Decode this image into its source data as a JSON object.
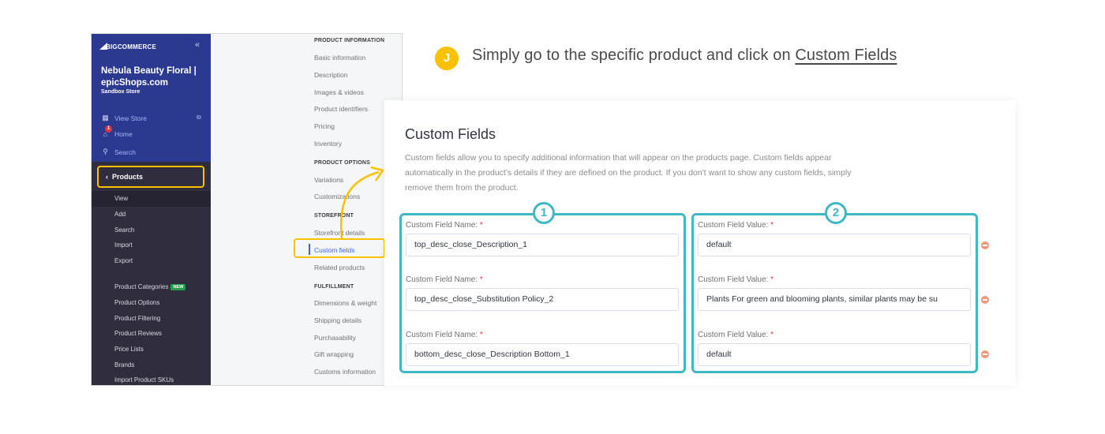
{
  "step": {
    "badge": "J",
    "text": "Simply go to the specific product and click on ",
    "link": "Custom Fields"
  },
  "sidebar": {
    "logo": "BIGCOMMERCE",
    "store_name": "Nebula Beauty Floral | epicShops.com",
    "store_type": "Sandbox Store",
    "top_items": [
      {
        "label": "View Store",
        "icon": "storefront-icon"
      },
      {
        "label": "Home",
        "icon": "home-icon",
        "badge": "1"
      },
      {
        "label": "Search",
        "icon": "search-icon"
      }
    ],
    "section": "Products",
    "sub_items": [
      "View",
      "Add",
      "Search",
      "Import",
      "Export"
    ],
    "more_items": [
      {
        "label": "Product Categories",
        "badge": "NEW"
      },
      {
        "label": "Product Options"
      },
      {
        "label": "Product Filtering"
      },
      {
        "label": "Product Reviews"
      },
      {
        "label": "Price Lists"
      },
      {
        "label": "Brands"
      },
      {
        "label": "Import Product SKUs"
      }
    ]
  },
  "subnav": {
    "sections": [
      {
        "heading": "PRODUCT INFORMATION",
        "items": [
          "Basic information",
          "Description",
          "Images & videos",
          "Product identifiers",
          "Pricing",
          "Inventory"
        ]
      },
      {
        "heading": "PRODUCT OPTIONS",
        "items": [
          "Variations",
          "Customizations"
        ]
      },
      {
        "heading": "STOREFRONT",
        "items": [
          "Storefront details",
          "Custom fields",
          "Related products"
        ]
      },
      {
        "heading": "FULFILLMENT",
        "items": [
          "Dimensions & weight",
          "Shipping details",
          "Purchasability",
          "Gift wrapping",
          "Customs information"
        ]
      }
    ],
    "active": "Custom fields"
  },
  "card": {
    "title": "Custom Fields",
    "description": "Custom fields allow you to specify additional information that will appear on the products page. Custom fields appear automatically in the product's details if they are defined on the product. If you don't want to show any custom fields, simply remove them from the product.",
    "name_label": "Custom Field Name:",
    "value_label": "Custom Field Value:",
    "required_mark": "*",
    "group_numbers": [
      "1",
      "2"
    ],
    "rows": [
      {
        "name": "top_desc_close_Description_1",
        "value": "default"
      },
      {
        "name": "top_desc_close_Substitution Policy_2",
        "value": "Plants For green and blooming plants, similar plants may be su"
      },
      {
        "name": "bottom_desc_close_Description Bottom_1",
        "value": "default"
      }
    ]
  },
  "colors": {
    "highlight": "#f9c100",
    "group_border": "#3fb8c6",
    "sidebar_blue": "#2b3990",
    "sidebar_dark": "#302e3e",
    "remove": "#f0967a"
  }
}
